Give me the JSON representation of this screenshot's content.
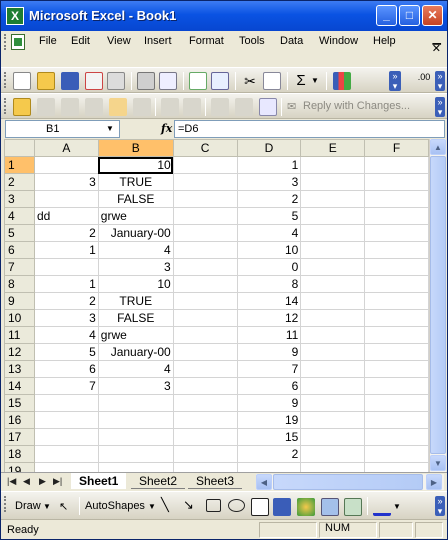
{
  "window": {
    "title": "Microsoft Excel - Book1"
  },
  "menu": [
    "File",
    "Edit",
    "View",
    "Insert",
    "Format",
    "Tools",
    "Data",
    "Window",
    "Help"
  ],
  "toolbar_review": {
    "reply_label": "Reply with Changes..."
  },
  "toolbar_std": {
    "sigma": "Σ",
    "inc_dec": ".00"
  },
  "formula": {
    "cell": "B1",
    "fx": "fx",
    "content": "=D6"
  },
  "grid": {
    "columns": [
      "A",
      "B",
      "C",
      "D",
      "E",
      "F"
    ],
    "rows": [
      [
        "1",
        "",
        "10",
        "",
        "1",
        "",
        ""
      ],
      [
        "2",
        "3",
        "TRUE",
        "",
        "3",
        "",
        ""
      ],
      [
        "3",
        "",
        "FALSE",
        "",
        "2",
        "",
        ""
      ],
      [
        "4",
        "dd",
        "grwe",
        "",
        "5",
        "",
        ""
      ],
      [
        "5",
        "2",
        "January-00",
        "",
        "4",
        "",
        ""
      ],
      [
        "6",
        "1",
        "4",
        "",
        "10",
        "",
        ""
      ],
      [
        "7",
        "",
        "3",
        "",
        "0",
        "",
        ""
      ],
      [
        "8",
        "1",
        "10",
        "",
        "8",
        "",
        ""
      ],
      [
        "9",
        "2",
        "TRUE",
        "",
        "14",
        "",
        ""
      ],
      [
        "10",
        "3",
        "FALSE",
        "",
        "12",
        "",
        ""
      ],
      [
        "11",
        "4",
        "grwe",
        "",
        "11",
        "",
        ""
      ],
      [
        "12",
        "5",
        "January-00",
        "",
        "9",
        "",
        ""
      ],
      [
        "13",
        "6",
        "4",
        "",
        "7",
        "",
        ""
      ],
      [
        "14",
        "7",
        "3",
        "",
        "6",
        "",
        ""
      ],
      [
        "15",
        "",
        "",
        "",
        "9",
        "",
        ""
      ],
      [
        "16",
        "",
        "",
        "",
        "19",
        "",
        ""
      ],
      [
        "17",
        "",
        "",
        "",
        "15",
        "",
        ""
      ],
      [
        "18",
        "",
        "",
        "",
        "2",
        "",
        ""
      ],
      [
        "19",
        "",
        "",
        "",
        "",
        "",
        ""
      ]
    ]
  },
  "sheets": [
    "Sheet1",
    "Sheet2",
    "Sheet3"
  ],
  "active_sheet": "Sheet1",
  "draw": {
    "draw_label": "Draw",
    "autoshapes_label": "AutoShapes"
  },
  "status": {
    "left": "Ready",
    "num": "NUM"
  }
}
